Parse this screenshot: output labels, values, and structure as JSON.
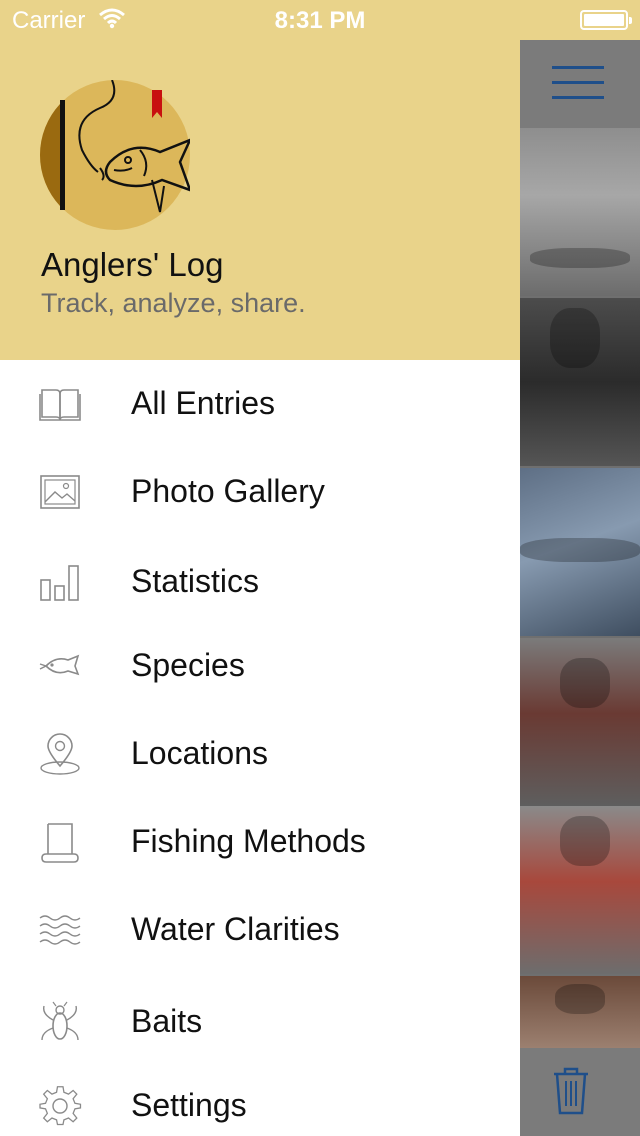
{
  "status_bar": {
    "carrier": "Carrier",
    "time": "8:31 PM"
  },
  "header": {
    "title": "Anglers' Log",
    "subtitle": "Track, analyze, share."
  },
  "menu": {
    "items": [
      {
        "label": "All Entries",
        "icon": "book-icon"
      },
      {
        "label": "Photo Gallery",
        "icon": "image-icon"
      },
      {
        "label": "Statistics",
        "icon": "bar-chart-icon"
      },
      {
        "label": "Species",
        "icon": "fish-icon"
      },
      {
        "label": "Locations",
        "icon": "map-pin-icon"
      },
      {
        "label": "Fishing Methods",
        "icon": "scroll-icon"
      },
      {
        "label": "Water Clarities",
        "icon": "waves-icon"
      },
      {
        "label": "Baits",
        "icon": "insect-icon"
      },
      {
        "label": "Settings",
        "icon": "gear-icon"
      }
    ]
  },
  "colors": {
    "header_bg": "#e9d38a",
    "accent_blue": "#1f4f8a",
    "logo_bg": "#dcb75a"
  }
}
